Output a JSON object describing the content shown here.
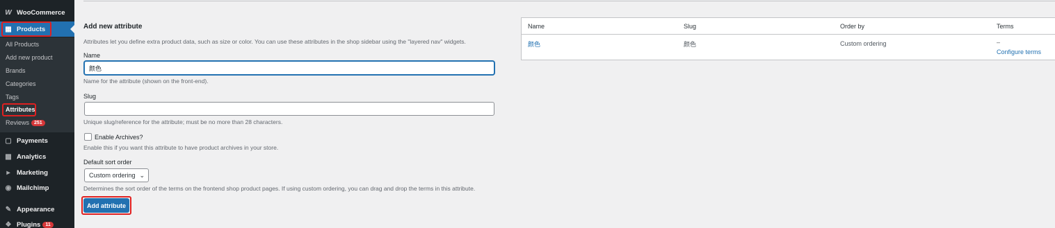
{
  "sidebar": {
    "woocommerce": "WooCommerce",
    "products": "Products",
    "submenu": {
      "all_products": "All Products",
      "add_new_product": "Add new product",
      "brands": "Brands",
      "categories": "Categories",
      "tags": "Tags",
      "attributes": "Attributes",
      "reviews": "Reviews",
      "reviews_count": "251"
    },
    "payments": "Payments",
    "analytics": "Analytics",
    "marketing": "Marketing",
    "mailchimp": "Mailchimp",
    "appearance": "Appearance",
    "plugins": "Plugins",
    "plugins_count": "11"
  },
  "form": {
    "title": "Add new attribute",
    "intro": "Attributes let you define extra product data, such as size or color. You can use these attributes in the shop sidebar using the \"layered nav\" widgets.",
    "name_label": "Name",
    "name_value": "颜色",
    "name_desc": "Name for the attribute (shown on the front-end).",
    "slug_label": "Slug",
    "slug_value": "",
    "slug_desc": "Unique slug/reference for the attribute; must be no more than 28 characters.",
    "archives_label": "Enable Archives?",
    "archives_desc": "Enable this if you want this attribute to have product archives in your store.",
    "sort_label": "Default sort order",
    "sort_value": "Custom ordering",
    "sort_desc": "Determines the sort order of the terms on the frontend shop product pages. If using custom ordering, you can drag and drop the terms in this attribute.",
    "submit_label": "Add attribute"
  },
  "table": {
    "headers": [
      "Name",
      "Slug",
      "Order by",
      "Terms"
    ],
    "rows": [
      {
        "name": "颜色",
        "slug": "颜色",
        "order_by": "Custom ordering",
        "terms": "–",
        "configure": "Configure terms"
      }
    ]
  }
}
